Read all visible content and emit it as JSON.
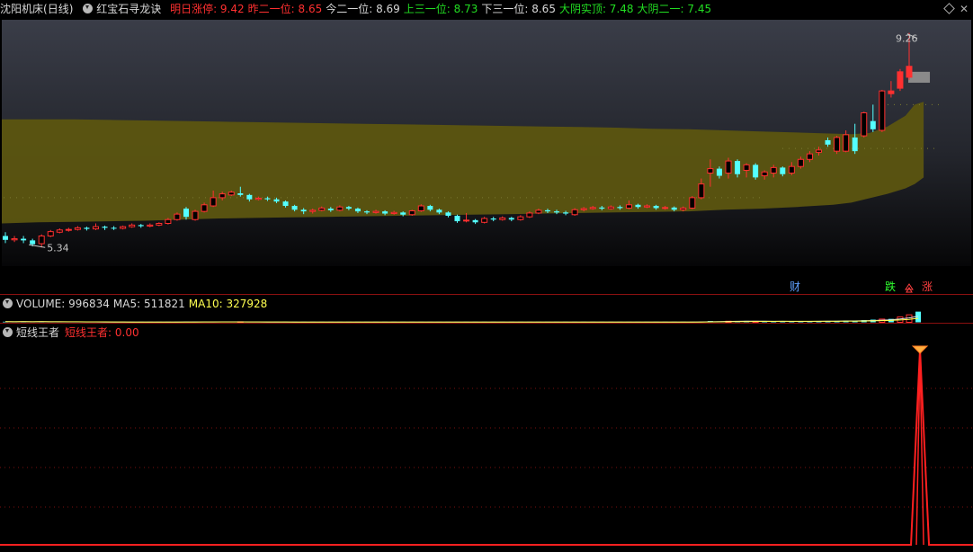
{
  "header": {
    "stock": "沈阳机床",
    "period": "(日线)",
    "formula": "红宝石寻龙诀",
    "close_icon": "close-icon",
    "fields": [
      {
        "label": "明日涨停:",
        "value": "9.42",
        "color": "#ff3030"
      },
      {
        "label": "昨二一位:",
        "value": "8.65",
        "color": "#ff3030"
      },
      {
        "label": "今二一位:",
        "value": "8.69",
        "color": "#d8d8d8"
      },
      {
        "label": "上三一位:",
        "value": "8.73",
        "color": "#22dd22"
      },
      {
        "label": "下三一位:",
        "value": "8.65",
        "color": "#d8d8d8"
      },
      {
        "label": "大阴实顶:",
        "value": "7.48",
        "color": "#22dd22"
      },
      {
        "label": "大阴二一:",
        "value": "7.45",
        "color": "#22dd22"
      }
    ]
  },
  "volume": {
    "fields": [
      {
        "label": "VOLUME:",
        "value": "996834",
        "color": "#d8d8d8"
      },
      {
        "label": "MA5:",
        "value": "511821",
        "color": "#d8d8d8"
      },
      {
        "label": "MA10:",
        "value": "327928",
        "color": "#ffff50"
      }
    ]
  },
  "indicator": {
    "name": "短线王者",
    "fields": [
      {
        "label": "短线王者:",
        "value": "0.00",
        "color": "#ff3030"
      }
    ]
  },
  "annotations": {
    "high_label": "9.26",
    "low_label": "5.34",
    "markers": [
      {
        "text": "财",
        "color": "#60a0ff"
      },
      {
        "text": "跌",
        "color": "#30ff30"
      },
      {
        "text": "涨",
        "color": "#ff4040"
      }
    ]
  },
  "colors": {
    "up": "#ff3030",
    "down": "#54ffff",
    "band": "#5c5510",
    "grid": "#7a1010"
  },
  "chart_data": [
    {
      "type": "candlestick",
      "title": "沈阳机床 (日线)",
      "ylim": [
        5.0,
        9.5
      ],
      "candles": [
        [
          5.55,
          5.48,
          5.62,
          5.42
        ],
        [
          5.48,
          5.5,
          5.55,
          5.44
        ],
        [
          5.5,
          5.47,
          5.55,
          5.42
        ],
        [
          5.47,
          5.4,
          5.5,
          5.36
        ],
        [
          5.41,
          5.55,
          5.58,
          5.34
        ],
        [
          5.55,
          5.63,
          5.66,
          5.53
        ],
        [
          5.62,
          5.66,
          5.69,
          5.6
        ],
        [
          5.66,
          5.67,
          5.7,
          5.63
        ],
        [
          5.67,
          5.7,
          5.73,
          5.65
        ],
        [
          5.7,
          5.68,
          5.72,
          5.65
        ],
        [
          5.68,
          5.72,
          5.78,
          5.66
        ],
        [
          5.72,
          5.7,
          5.74,
          5.66
        ],
        [
          5.7,
          5.69,
          5.73,
          5.66
        ],
        [
          5.69,
          5.72,
          5.74,
          5.67
        ],
        [
          5.72,
          5.75,
          5.78,
          5.7
        ],
        [
          5.75,
          5.73,
          5.77,
          5.7
        ],
        [
          5.73,
          5.75,
          5.78,
          5.71
        ],
        [
          5.75,
          5.78,
          5.8,
          5.73
        ],
        [
          5.78,
          5.85,
          5.88,
          5.76
        ],
        [
          5.85,
          5.95,
          5.98,
          5.83
        ],
        [
          6.05,
          5.9,
          6.08,
          5.85
        ],
        [
          5.85,
          6.0,
          6.03,
          5.83
        ],
        [
          6.0,
          6.12,
          6.16,
          5.98
        ],
        [
          6.1,
          6.25,
          6.38,
          6.08
        ],
        [
          6.25,
          6.32,
          6.36,
          6.2
        ],
        [
          6.3,
          6.35,
          6.38,
          6.28
        ],
        [
          6.33,
          6.3,
          6.45,
          6.27
        ],
        [
          6.3,
          6.22,
          6.32,
          6.18
        ],
        [
          6.22,
          6.24,
          6.27,
          6.2
        ],
        [
          6.24,
          6.22,
          6.27,
          6.19
        ],
        [
          6.22,
          6.18,
          6.25,
          6.15
        ],
        [
          6.18,
          6.1,
          6.2,
          6.07
        ],
        [
          6.1,
          6.03,
          6.12,
          6.0
        ],
        [
          6.03,
          6.0,
          6.06,
          5.95
        ],
        [
          6.0,
          6.02,
          6.05,
          5.96
        ],
        [
          6.02,
          6.06,
          6.09,
          6.0
        ],
        [
          6.05,
          6.02,
          6.08,
          5.99
        ],
        [
          6.02,
          6.08,
          6.11,
          6.0
        ],
        [
          6.08,
          6.05,
          6.1,
          6.02
        ],
        [
          6.05,
          6.0,
          6.07,
          5.97
        ],
        [
          6.0,
          5.98,
          6.02,
          5.95
        ],
        [
          5.98,
          6.0,
          6.03,
          5.96
        ],
        [
          6.0,
          5.96,
          6.02,
          5.93
        ],
        [
          5.96,
          5.98,
          6.01,
          5.94
        ],
        [
          5.98,
          5.94,
          6.0,
          5.91
        ],
        [
          5.94,
          6.01,
          6.03,
          5.92
        ],
        [
          6.01,
          6.1,
          6.13,
          5.99
        ],
        [
          6.1,
          6.03,
          6.12,
          6.0
        ],
        [
          6.03,
          5.98,
          6.05,
          5.95
        ],
        [
          5.98,
          5.92,
          6.0,
          5.89
        ],
        [
          5.92,
          5.82,
          5.94,
          5.79
        ],
        [
          5.83,
          5.84,
          5.97,
          5.8
        ],
        [
          5.84,
          5.8,
          5.86,
          5.77
        ],
        [
          5.8,
          5.87,
          5.9,
          5.78
        ],
        [
          5.87,
          5.85,
          5.9,
          5.82
        ],
        [
          5.85,
          5.88,
          5.91,
          5.83
        ],
        [
          5.88,
          5.85,
          5.9,
          5.82
        ],
        [
          5.85,
          5.9,
          5.93,
          5.83
        ],
        [
          5.9,
          5.97,
          6.0,
          5.88
        ],
        [
          5.97,
          6.02,
          6.05,
          5.95
        ],
        [
          6.02,
          6.0,
          6.05,
          5.97
        ],
        [
          6.0,
          5.98,
          6.03,
          5.95
        ],
        [
          5.98,
          5.96,
          6.01,
          5.93
        ],
        [
          5.94,
          6.03,
          6.06,
          5.92
        ],
        [
          6.03,
          6.05,
          6.08,
          6.0
        ],
        [
          6.05,
          6.07,
          6.1,
          6.03
        ],
        [
          6.07,
          6.05,
          6.1,
          6.02
        ],
        [
          6.05,
          6.08,
          6.11,
          6.03
        ],
        [
          6.08,
          6.06,
          6.11,
          6.03
        ],
        [
          6.06,
          6.12,
          6.2,
          6.04
        ],
        [
          6.12,
          6.08,
          6.14,
          6.05
        ],
        [
          6.08,
          6.1,
          6.13,
          6.06
        ],
        [
          6.1,
          6.06,
          6.12,
          6.03
        ],
        [
          6.06,
          6.07,
          6.1,
          6.03
        ],
        [
          6.07,
          6.03,
          6.09,
          6.0
        ],
        [
          6.03,
          6.06,
          6.09,
          6.0
        ],
        [
          6.06,
          6.25,
          6.28,
          6.04
        ],
        [
          6.25,
          6.5,
          6.6,
          6.22
        ],
        [
          6.7,
          6.78,
          6.95,
          6.45
        ],
        [
          6.78,
          6.65,
          6.82,
          6.6
        ],
        [
          6.7,
          6.92,
          6.98,
          6.6
        ],
        [
          6.92,
          6.68,
          6.95,
          6.62
        ],
        [
          6.75,
          6.85,
          6.88,
          6.62
        ],
        [
          6.85,
          6.62,
          6.88,
          6.58
        ],
        [
          6.65,
          6.72,
          6.75,
          6.58
        ],
        [
          6.7,
          6.8,
          6.85,
          6.62
        ],
        [
          6.8,
          6.68,
          6.82,
          6.64
        ],
        [
          6.7,
          6.82,
          6.9,
          6.66
        ],
        [
          6.82,
          6.95,
          7.0,
          6.78
        ],
        [
          6.95,
          7.05,
          7.1,
          6.9
        ],
        [
          7.08,
          7.12,
          7.18,
          7.02
        ],
        [
          7.3,
          7.22,
          7.35,
          7.18
        ],
        [
          7.1,
          7.35,
          7.38,
          7.05
        ],
        [
          7.1,
          7.4,
          7.48,
          7.08
        ],
        [
          7.35,
          7.1,
          7.6,
          7.05
        ],
        [
          7.38,
          7.8,
          7.82,
          7.35
        ],
        [
          7.65,
          7.5,
          7.95,
          7.45
        ],
        [
          7.48,
          8.2,
          8.22,
          7.45
        ],
        [
          8.15,
          8.2,
          8.38,
          8.08
        ],
        [
          8.25,
          8.55,
          8.6,
          8.2
        ],
        [
          8.45,
          8.65,
          9.26,
          8.4
        ]
      ],
      "band_upper": [
        [
          0,
          7.68
        ],
        [
          4,
          7.68
        ],
        [
          8,
          7.68
        ],
        [
          12,
          7.67
        ],
        [
          16,
          7.66
        ],
        [
          20,
          7.65
        ],
        [
          24,
          7.64
        ],
        [
          28,
          7.63
        ],
        [
          32,
          7.62
        ],
        [
          36,
          7.61
        ],
        [
          40,
          7.6
        ],
        [
          44,
          7.59
        ],
        [
          48,
          7.58
        ],
        [
          52,
          7.57
        ],
        [
          56,
          7.56
        ],
        [
          60,
          7.55
        ],
        [
          64,
          7.54
        ],
        [
          68,
          7.53
        ],
        [
          72,
          7.51
        ],
        [
          76,
          7.5
        ],
        [
          80,
          7.48
        ],
        [
          84,
          7.46
        ],
        [
          88,
          7.44
        ],
        [
          92,
          7.42
        ],
        [
          94,
          7.41
        ],
        [
          96,
          7.43
        ],
        [
          98,
          7.55
        ],
        [
          100,
          7.75
        ],
        [
          101,
          7.95
        ],
        [
          102,
          8.0
        ]
      ],
      "band_lower": [
        [
          0,
          5.78
        ],
        [
          4,
          5.8
        ],
        [
          8,
          5.81
        ],
        [
          12,
          5.82
        ],
        [
          16,
          5.83
        ],
        [
          20,
          5.85
        ],
        [
          24,
          5.87
        ],
        [
          28,
          5.88
        ],
        [
          32,
          5.89
        ],
        [
          36,
          5.9
        ],
        [
          40,
          5.91
        ],
        [
          44,
          5.92
        ],
        [
          48,
          5.93
        ],
        [
          52,
          5.94
        ],
        [
          56,
          5.95
        ],
        [
          60,
          5.96
        ],
        [
          64,
          5.97
        ],
        [
          68,
          5.98
        ],
        [
          72,
          5.99
        ],
        [
          76,
          6.0
        ],
        [
          80,
          6.03
        ],
        [
          84,
          6.05
        ],
        [
          88,
          6.08
        ],
        [
          92,
          6.12
        ],
        [
          94,
          6.16
        ],
        [
          96,
          6.24
        ],
        [
          98,
          6.32
        ],
        [
          100,
          6.42
        ],
        [
          101,
          6.5
        ],
        [
          102,
          6.62
        ]
      ],
      "signal_box": {
        "index": 101,
        "low": 8.35,
        "high": 8.55
      }
    },
    {
      "type": "bar",
      "title": "VOLUME",
      "up_indices": [
        26,
        80,
        83,
        97,
        99,
        100,
        102
      ],
      "values": [
        55,
        50,
        60,
        45,
        70,
        40,
        35,
        30,
        32,
        28,
        30,
        25,
        22,
        24,
        26,
        22,
        24,
        28,
        30,
        40,
        45,
        30,
        32,
        38,
        60,
        35,
        30,
        25,
        22,
        20,
        18,
        17,
        16,
        18,
        20,
        19,
        18,
        17,
        16,
        15,
        17,
        18,
        16,
        15,
        14,
        17,
        20,
        18,
        16,
        15,
        18,
        20,
        16,
        15,
        17,
        16,
        15,
        18,
        20,
        22,
        20,
        18,
        16,
        20,
        22,
        24,
        22,
        20,
        21,
        24,
        22,
        20,
        18,
        19,
        17,
        18,
        40,
        60,
        120,
        90,
        100,
        85,
        130,
        90,
        80,
        85,
        70,
        80,
        90,
        100,
        110,
        120,
        130,
        150,
        120,
        200,
        250,
        300,
        320,
        500,
        700,
        996.834
      ],
      "ylim": [
        0,
        1050
      ]
    },
    {
      "type": "line",
      "title": "短线王者",
      "ylim": [
        0,
        100
      ],
      "values_nonzero": [
        {
          "index": 101,
          "value": 100
        }
      ],
      "base_value": 0
    }
  ]
}
